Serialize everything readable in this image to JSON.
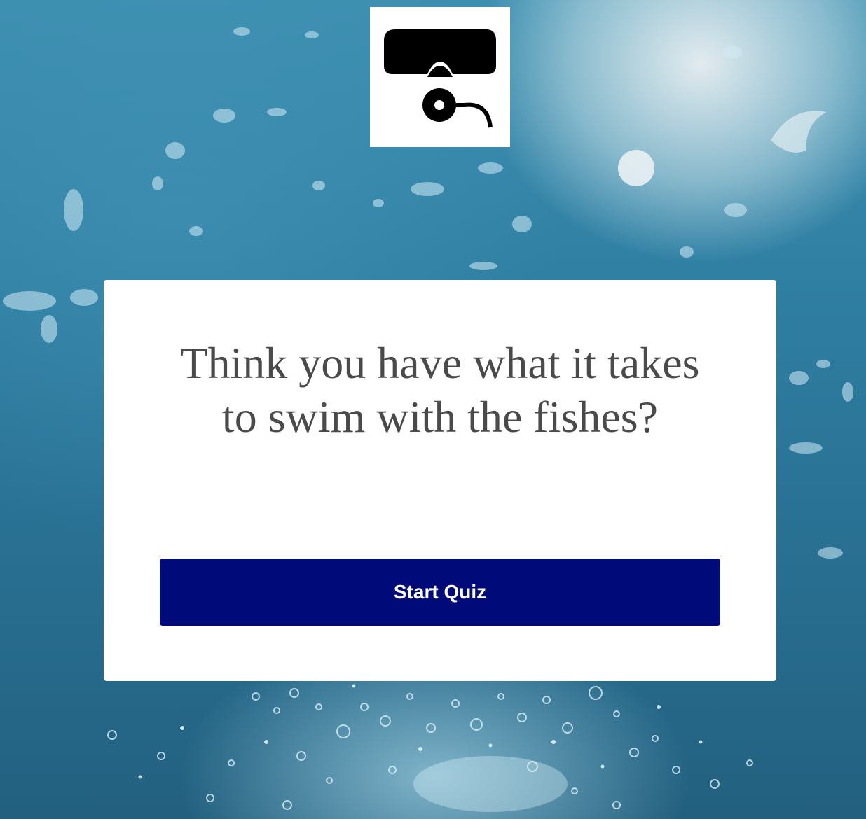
{
  "logo": {
    "icon": "diving-mask-snorkel-icon"
  },
  "intro": {
    "headline": "Think you have what it takes to swim with the fishes?",
    "start_label": "Start Quiz"
  },
  "colors": {
    "button_bg": "#000a78",
    "button_text": "#ffffff",
    "headline_text": "#4a4a4a",
    "card_bg": "#ffffff",
    "water": "#2f7fa3"
  }
}
